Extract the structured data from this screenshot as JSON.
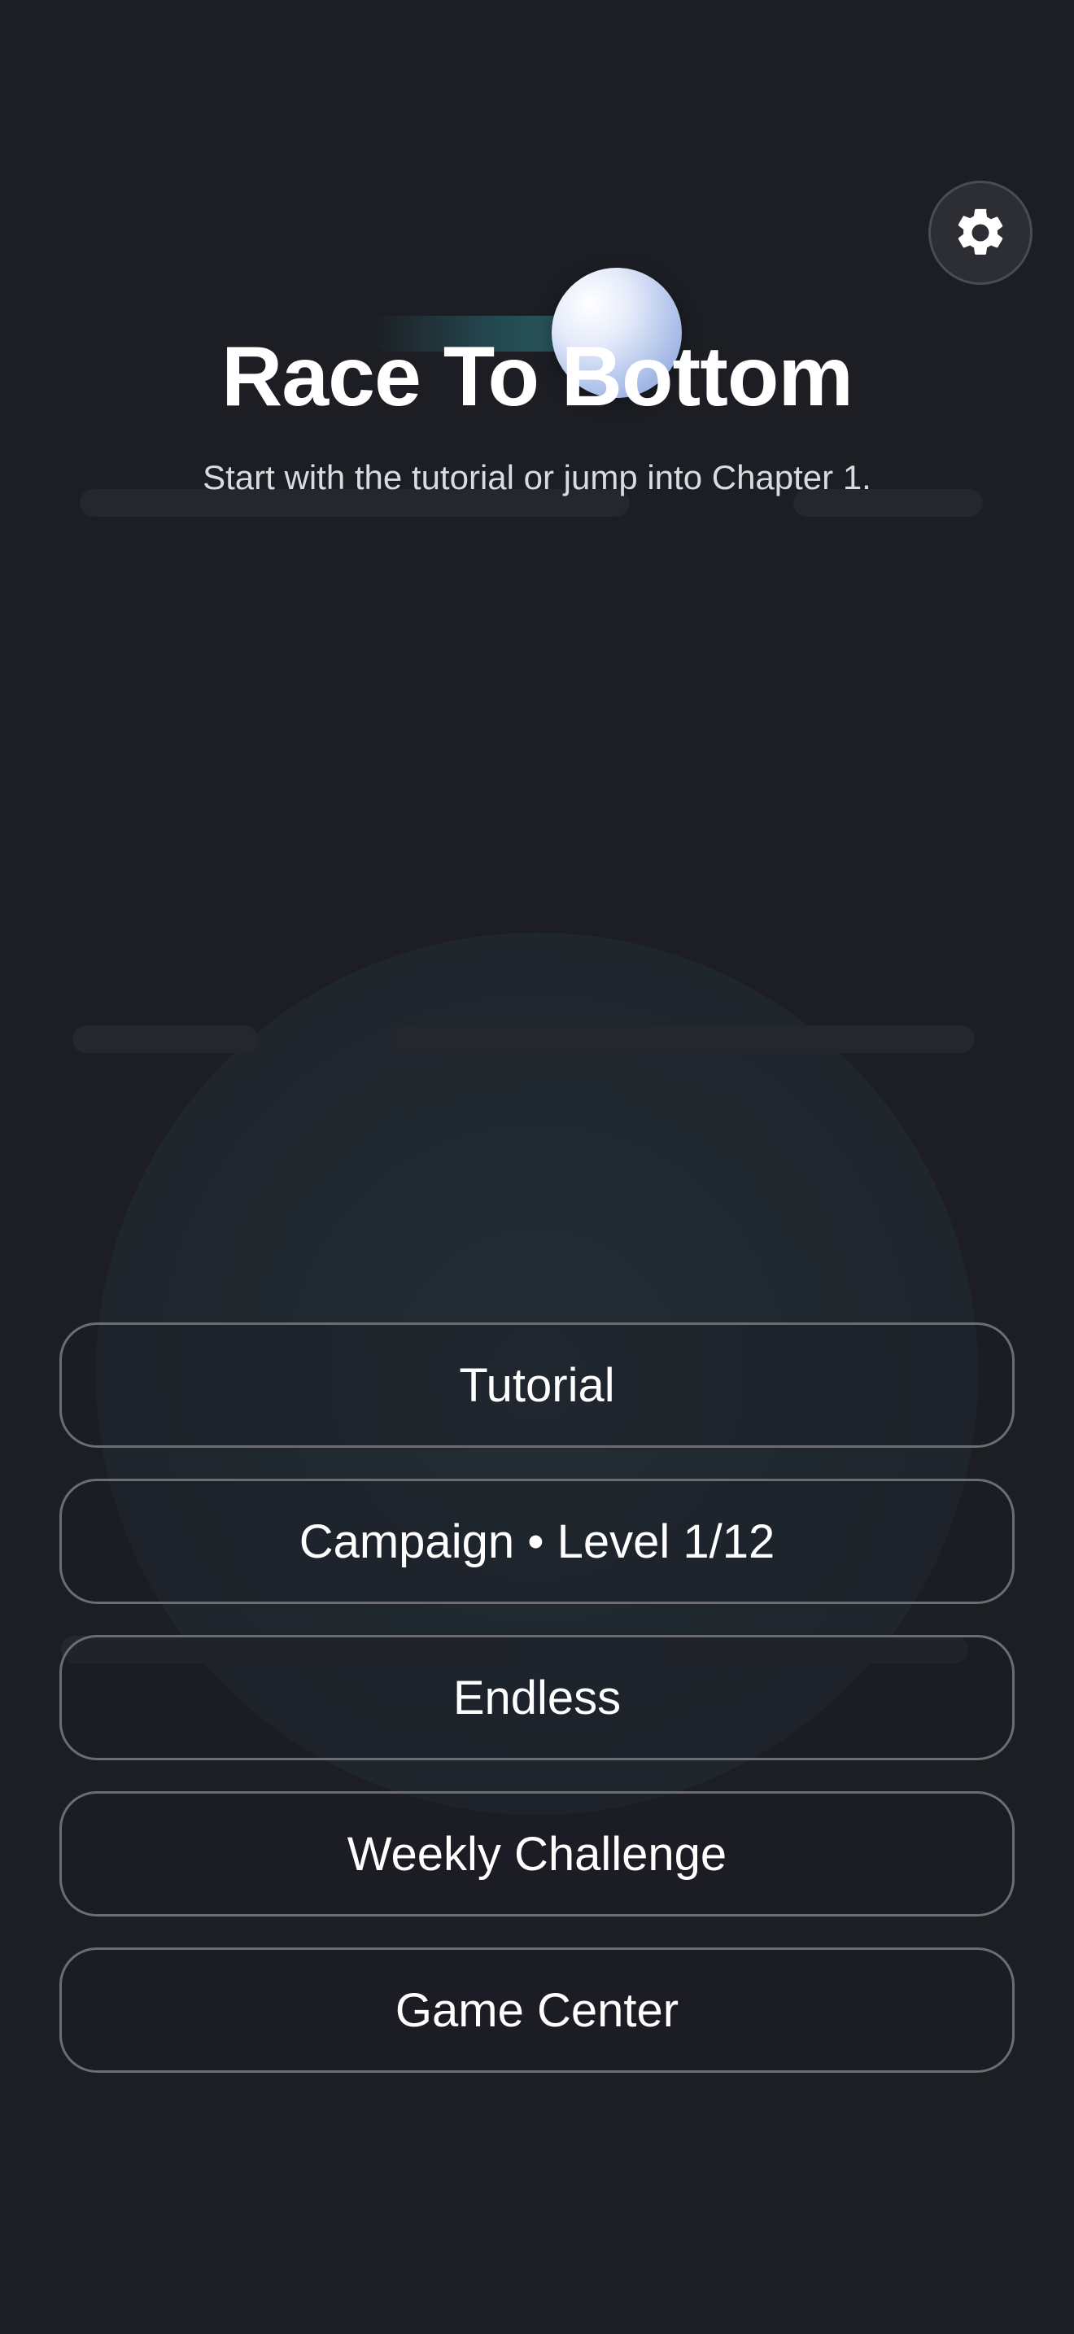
{
  "app": {
    "title": "Race To Bottom",
    "subtitle": "Start with the tutorial or jump into Chapter 1."
  },
  "header": {
    "settings_icon": "gear-icon"
  },
  "menu": {
    "items": [
      {
        "label": "Tutorial"
      },
      {
        "label": "Campaign • Level 1/12"
      },
      {
        "label": "Endless"
      },
      {
        "label": "Weekly Challenge"
      },
      {
        "label": "Game Center"
      }
    ]
  },
  "theme": {
    "background": "#1c1e24",
    "button_border": "#6b6d72",
    "ball_color": "#a9bde8",
    "platform_color": "#24272e"
  }
}
